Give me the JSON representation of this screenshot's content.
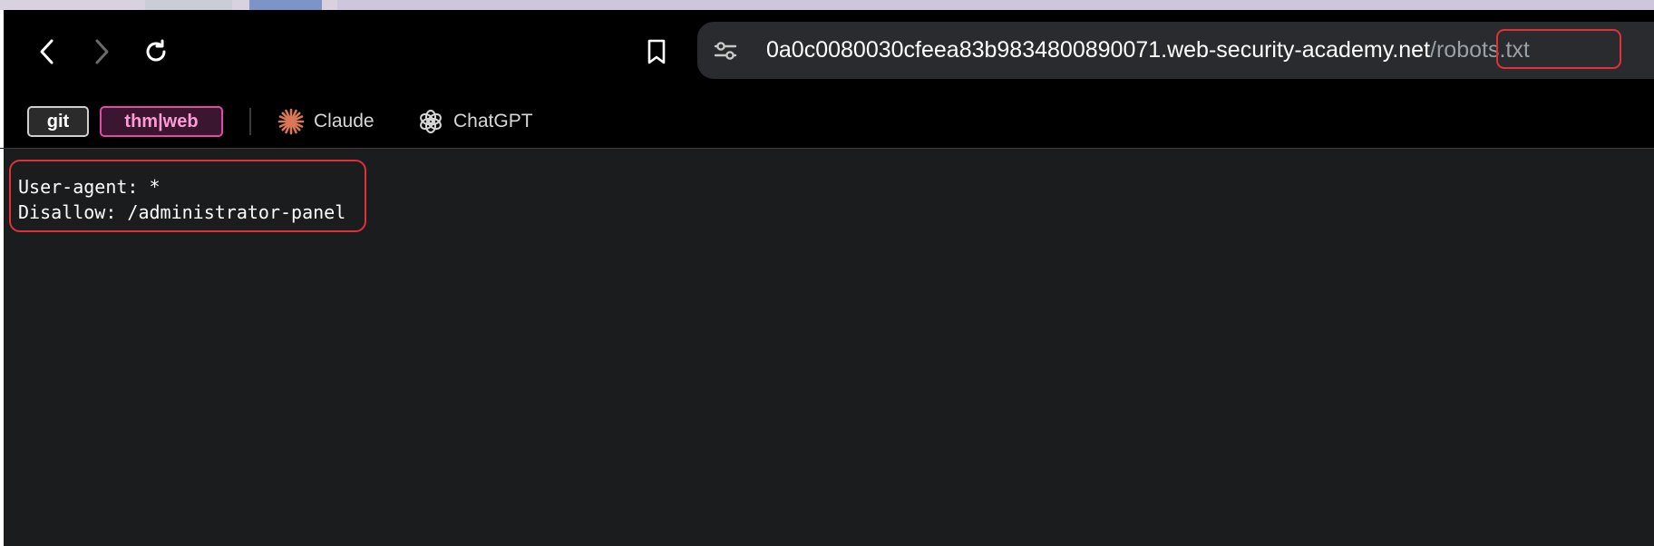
{
  "browser": {
    "url": {
      "host": "0a0c0080030cfeea83b9834800890071.web-security-academy.net",
      "path": "/robots.txt"
    },
    "nav": {
      "back_icon": "chevron-left-icon",
      "forward_icon": "chevron-right-icon",
      "reload_icon": "reload-icon",
      "bookmark_icon": "bookmark-icon",
      "site_settings_icon": "tune-icon"
    }
  },
  "bookmarks": [
    {
      "label": "git",
      "style": "chip"
    },
    {
      "label": "thm|web",
      "style": "chip",
      "accent": "#e24aa8"
    },
    {
      "label": "Claude",
      "icon": "claude-sparkle-icon",
      "icon_color": "#d97757"
    },
    {
      "label": "ChatGPT",
      "icon": "openai-knot-icon"
    }
  ],
  "page": {
    "robots_lines": [
      "User-agent: *",
      "Disallow: /administrator-panel"
    ]
  },
  "colors": {
    "chrome_bg": "#000000",
    "omnibox_bg": "#2a2b2e",
    "content_bg": "#1b1c1e",
    "highlight": "#e0303a"
  }
}
